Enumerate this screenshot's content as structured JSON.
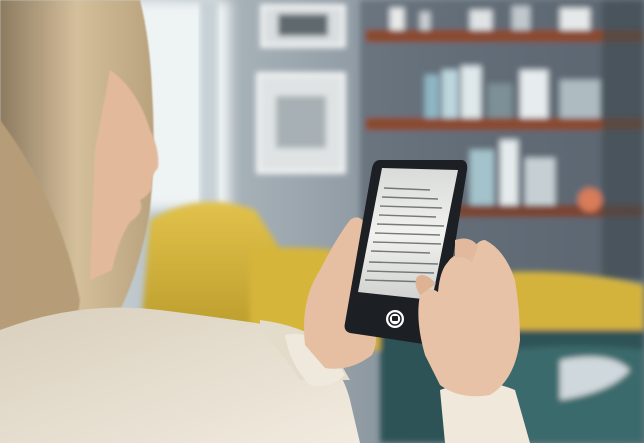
{
  "photo": {
    "subject": "woman-scanning-document-with-phone",
    "colors": {
      "wall": "#8a96a0",
      "window_light": "#e4ecef",
      "sofa_yellow": "#d8b83a",
      "sofa_shadow": "#b89a2a",
      "shelf_wood": "#8b4a2e",
      "hair": "#c9b28e",
      "skin": "#e8c2a6",
      "sweater": "#e9e1d2",
      "phone_body": "#1c1f24",
      "phone_screen_paper": "#ececea",
      "cushion_teal": "#2f5a5e"
    }
  },
  "phone_ui": {
    "shutter_icon": "camera-icon"
  }
}
